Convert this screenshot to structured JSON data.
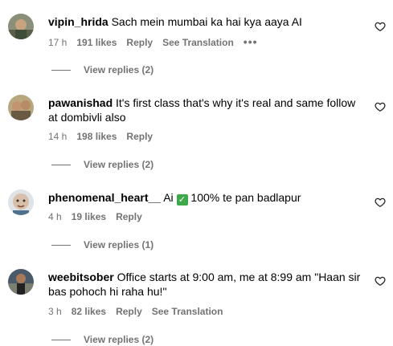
{
  "comments": [
    {
      "username": "vipin_hrida",
      "text": "Sach mein mumbai ka hai kya aaya AI",
      "time": "17 h",
      "likes": "191 likes",
      "reply": "Reply",
      "translation": "See Translation",
      "more": "•••",
      "view_replies": "View replies (2)"
    },
    {
      "username": "pawanishad",
      "text": "It's first class that's why it's real and same follow at dombivli also",
      "time": "14 h",
      "likes": "198 likes",
      "reply": "Reply",
      "view_replies": "View replies (2)"
    },
    {
      "username": "phenomenal_heart__",
      "text_before": "Ai",
      "emoji": "✓",
      "text_after": "100% te pan badlapur",
      "time": "4 h",
      "likes": "19 likes",
      "reply": "Reply",
      "view_replies": "View replies (1)"
    },
    {
      "username": "weebitsober",
      "text": "Office starts at 9:00 am, me at 8:99 am \"Haan sir bas pohoch hi raha hu!\"",
      "time": "3 h",
      "likes": "82 likes",
      "reply": "Reply",
      "translation": "See Translation",
      "view_replies": "View replies (2)"
    }
  ],
  "icons": {
    "like": "heart-outline-icon",
    "more": "more-horizontal-icon"
  }
}
